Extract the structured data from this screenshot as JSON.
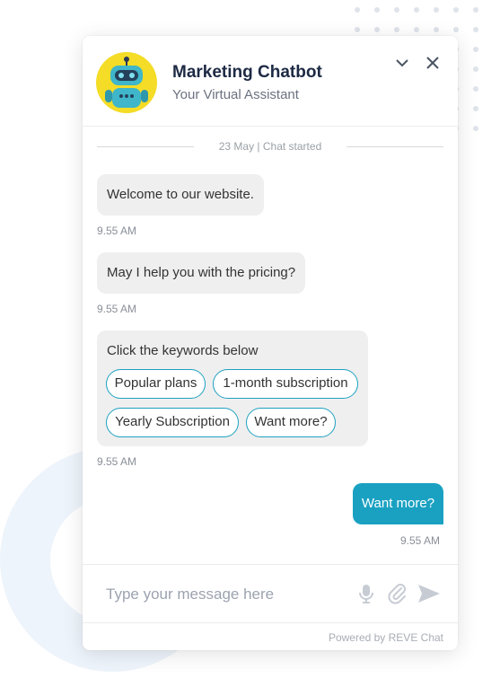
{
  "header": {
    "title": "Marketing Chatbot",
    "subtitle": "Your Virtual Assistant",
    "avatar_icon": "robot-icon",
    "minimize_icon": "chevron-down-icon",
    "close_icon": "close-icon"
  },
  "chat": {
    "date_label": "23 May | Chat started",
    "messages": [
      {
        "text": "Welcome to our website.",
        "time": "9.55 AM"
      },
      {
        "text": "May I help you with the pricing?",
        "time": "9.55 AM"
      }
    ],
    "keywords": {
      "label": "Click the keywords below",
      "chips": [
        "Popular plans",
        "1-month subscription",
        "Yearly Subscription",
        "Want more?"
      ],
      "time": "9.55 AM"
    },
    "user_message": {
      "text": "Want more?",
      "time": "9.55 AM"
    }
  },
  "composer": {
    "placeholder": "Type your message here",
    "mic_icon": "microphone-icon",
    "attach_icon": "paperclip-icon",
    "send_icon": "send-icon"
  },
  "footer": {
    "powered_by": "Powered by REVE Chat"
  },
  "colors": {
    "accent": "#1aa1c2",
    "bubble_bg": "#efefef",
    "title": "#1d2a44"
  }
}
